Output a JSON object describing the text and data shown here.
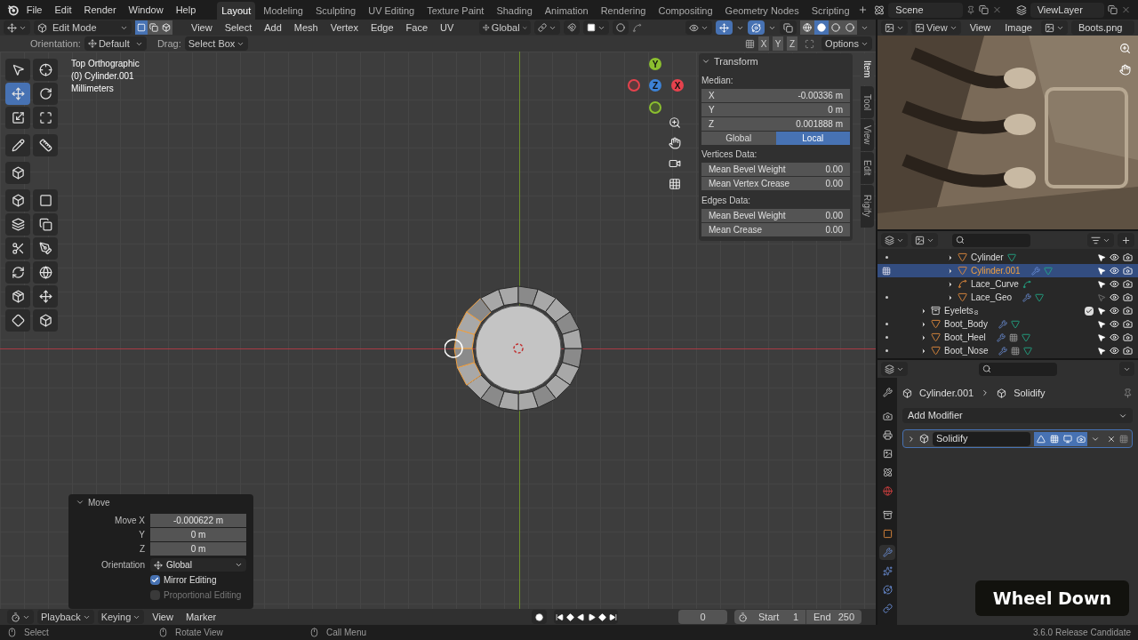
{
  "top_bar": {
    "menus": [
      "File",
      "Edit",
      "Render",
      "Window",
      "Help"
    ],
    "workspaces": [
      {
        "label": "Layout",
        "selected": true
      },
      {
        "label": "Modeling",
        "selected": false
      },
      {
        "label": "Sculpting",
        "selected": false
      },
      {
        "label": "UV Editing",
        "selected": false
      },
      {
        "label": "Texture Paint",
        "selected": false
      },
      {
        "label": "Shading",
        "selected": false
      },
      {
        "label": "Animation",
        "selected": false
      },
      {
        "label": "Rendering",
        "selected": false
      },
      {
        "label": "Compositing",
        "selected": false
      },
      {
        "label": "Geometry Nodes",
        "selected": false
      },
      {
        "label": "Scripting",
        "selected": false
      }
    ],
    "scene": "Scene",
    "view_layer": "ViewLayer"
  },
  "viewport": {
    "header": {
      "mode": "Edit Mode",
      "select_modes": [
        {
          "selected": true
        },
        {
          "selected": false
        },
        {
          "selected": false
        }
      ],
      "menus": [
        "View",
        "Select",
        "Add",
        "Mesh",
        "Vertex",
        "Edge",
        "Face",
        "UV"
      ],
      "orientation": "Global",
      "gizmos_on": true,
      "overlays_on": true,
      "xray_on": false,
      "shading": [
        {
          "selected": false
        },
        {
          "selected": true
        },
        {
          "selected": false
        },
        {
          "selected": false
        }
      ]
    },
    "tool_settings": {
      "orientation_label": "Orientation:",
      "orientation": "Default",
      "drag_label": "Drag:",
      "drag": "Select Box",
      "mirror_axes": [
        {
          "label": "X",
          "selected": false
        },
        {
          "label": "Y",
          "selected": false
        },
        {
          "label": "Z",
          "selected": false
        }
      ],
      "options": "Options"
    },
    "info": [
      "Top Orthographic",
      "(0) Cylinder.001",
      "Millimeters"
    ],
    "gizmo_axes": [
      {
        "label": "Y",
        "color": "#8bbf2f"
      },
      {
        "label": "Z",
        "color": "#3d82d6"
      },
      {
        "label": "X",
        "color": "#e5424d"
      }
    ],
    "toolbar": {
      "groups": [
        {
          "tools": [
            {
              "selected": false
            },
            {
              "selected": false
            },
            {
              "selected": true
            },
            {
              "selected": false
            },
            {
              "selected": false
            },
            {
              "selected": false
            }
          ]
        },
        {
          "tools": [
            {
              "selected": false
            },
            {
              "selected": false
            }
          ]
        },
        {
          "tools": [
            {
              "selected": false
            }
          ]
        },
        {
          "tools": [
            {
              "selected": false
            },
            {
              "selected": false
            },
            {
              "selected": false
            },
            {
              "selected": false
            },
            {
              "selected": false
            },
            {
              "selected": false
            },
            {
              "selected": false
            },
            {
              "selected": false
            },
            {
              "selected": false
            },
            {
              "selected": false
            },
            {
              "selected": false
            },
            {
              "selected": false
            }
          ]
        }
      ]
    },
    "sidebar": {
      "tabs": [
        {
          "label": "Item",
          "selected": true
        },
        {
          "label": "Tool",
          "selected": false
        },
        {
          "label": "View",
          "selected": false
        },
        {
          "label": "Edit",
          "selected": false
        },
        {
          "label": "Rigify",
          "selected": false
        }
      ],
      "panel": {
        "title": "Transform",
        "median_label": "Median:",
        "fields": [
          {
            "label": "X",
            "value": "-0.00336 m"
          },
          {
            "label": "Y",
            "value": "0 m"
          },
          {
            "label": "Z",
            "value": "0.001888 m"
          }
        ],
        "space": [
          {
            "label": "Global",
            "selected": false
          },
          {
            "label": "Local",
            "selected": true
          }
        ],
        "sections": [
          {
            "title": "Vertices Data:",
            "rows": [
              {
                "label": "Mean Bevel Weight",
                "value": "0.00"
              },
              {
                "label": "Mean Vertex Crease",
                "value": "0.00"
              }
            ]
          },
          {
            "title": "Edges Data:",
            "rows": [
              {
                "label": "Mean Bevel Weight",
                "value": "0.00"
              },
              {
                "label": "Mean Crease",
                "value": "0.00"
              }
            ]
          }
        ]
      }
    },
    "redo_panel": {
      "title": "Move",
      "fields": [
        {
          "label": "Move X",
          "value": "-0.000622 m"
        },
        {
          "label": "Y",
          "value": "0 m"
        },
        {
          "label": "Z",
          "value": "0 m"
        }
      ],
      "orientation_label": "Orientation",
      "orientation": "Global",
      "options": [
        {
          "label": "Mirror Editing",
          "checked": true,
          "disabled": false
        },
        {
          "label": "Proportional Editing",
          "checked": false,
          "disabled": true
        }
      ]
    }
  },
  "timeline": {
    "menus": [
      "Playback",
      "Keying",
      "View",
      "Marker"
    ],
    "frame": "0",
    "start_label": "Start",
    "start": "1",
    "end_label": "End",
    "end": "250"
  },
  "image_editor": {
    "view_dropdown": "View",
    "menus": [
      "View",
      "Image"
    ],
    "image": "Boots.png"
  },
  "outliner": {
    "rows": [
      {
        "children": [
          {
            "name": "Cylinder",
            "kind": "mesh",
            "selected": false,
            "dot": true,
            "editing": false,
            "modifier": false,
            "extra": false,
            "selectable": true
          },
          {
            "name": "Cylinder.001",
            "kind": "mesh",
            "selected": true,
            "dot": false,
            "editing": true,
            "modifier": true,
            "extra": false,
            "selectable": true
          },
          {
            "name": "Lace_Curve",
            "kind": "curve",
            "selected": false,
            "dot": false,
            "editing": false,
            "modifier": false,
            "extra": false,
            "selectable": true
          },
          {
            "name": "Lace_Geo",
            "kind": "mesh",
            "selected": false,
            "dot": true,
            "editing": false,
            "modifier": true,
            "extra": false,
            "selectable": false
          }
        ]
      },
      {
        "name": "Eyelets",
        "kind": "collection",
        "count": "8",
        "checked": true,
        "selected": false,
        "dot": false,
        "editing": false,
        "modifier": false,
        "extra": false,
        "selectable": true
      },
      {
        "name": "Boot_Body",
        "kind": "mesh",
        "selected": false,
        "dot": true,
        "editing": false,
        "modifier": true,
        "extra": false,
        "selectable": true
      },
      {
        "name": "Boot_Heel",
        "kind": "mesh",
        "selected": false,
        "dot": true,
        "editing": false,
        "modifier": true,
        "extra": true,
        "selectable": true
      },
      {
        "name": "Boot_Nose",
        "kind": "mesh",
        "selected": false,
        "dot": true,
        "editing": false,
        "modifier": true,
        "extra": true,
        "selectable": true
      }
    ]
  },
  "properties": {
    "tabs": [
      {
        "selected": false
      },
      {
        "selected": false
      },
      {
        "selected": false
      },
      {
        "selected": false
      },
      {
        "selected": false
      },
      {
        "selected": false
      },
      {
        "selected": false
      },
      {
        "selected": false
      },
      {
        "selected": true
      },
      {
        "selected": false
      },
      {
        "selected": false
      },
      {
        "selected": false
      }
    ],
    "breadcrumb": [
      "Cylinder.001",
      "Solidify"
    ],
    "add_modifier": "Add Modifier",
    "modifiers": [
      {
        "name": "Solidify",
        "expanded": false,
        "toggles": [
          {
            "on": true
          },
          {
            "on": true
          },
          {
            "on": true
          },
          {
            "on": true
          }
        ]
      }
    ]
  },
  "status_bar": {
    "hints": [
      "Select",
      "Rotate View",
      "Call Menu"
    ],
    "version": "3.6.0 Release Candidate"
  },
  "key_overlay": "Wheel Down"
}
